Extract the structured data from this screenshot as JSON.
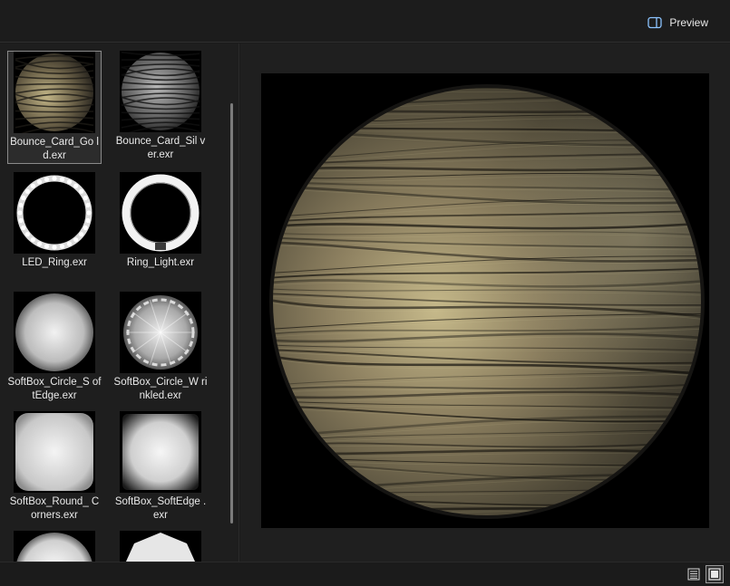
{
  "header": {
    "preview_label": "Preview",
    "preview_icon": "panel-toggle-icon"
  },
  "library": {
    "selected_index": 0,
    "items": [
      {
        "name": "Bounce_Card_Go ld.exr",
        "thumb": "gold-reflector"
      },
      {
        "name": "Bounce_Card_Sil ver.exr",
        "thumb": "silver-reflector"
      },
      {
        "name": "LED_Ring.exr",
        "thumb": "led-ring"
      },
      {
        "name": "Ring_Light.exr",
        "thumb": "ring-light"
      },
      {
        "name": "SoftBox_Circle_S oftEdge.exr",
        "thumb": "softbox-circle"
      },
      {
        "name": "SoftBox_Circle_W rinkled.exr",
        "thumb": "softbox-circle-wrinkled"
      },
      {
        "name": "SoftBox_Round_ Corners.exr",
        "thumb": "softbox-round"
      },
      {
        "name": "SoftBox_SoftEdge .exr",
        "thumb": "softbox-soft"
      },
      {
        "name": "",
        "thumb": "softbox-partial-a"
      },
      {
        "name": "",
        "thumb": "softbox-partial-b"
      }
    ]
  },
  "preview": {
    "image": "Bounce_Card_Gold preview"
  },
  "statusbar": {
    "list_view_icon": "list-view-icon",
    "grid_view_icon": "grid-view-icon",
    "active_view": "grid"
  },
  "colors": {
    "gold_tint": "#b4a878",
    "background": "#1e1e1e"
  }
}
